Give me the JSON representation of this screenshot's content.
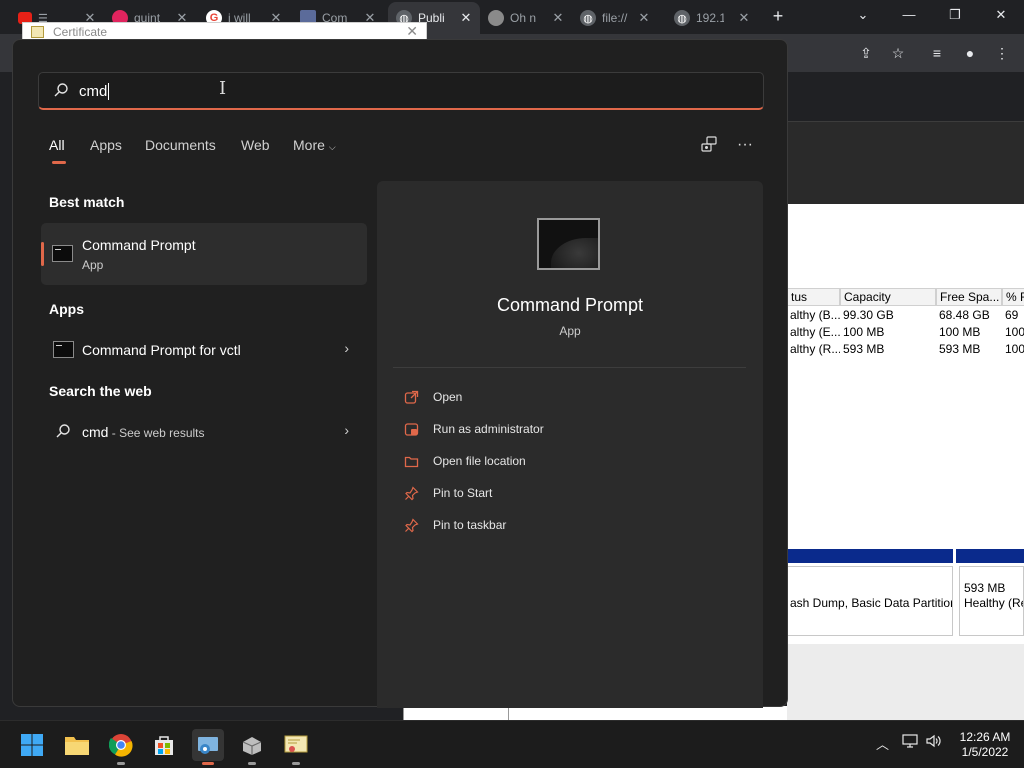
{
  "browser": {
    "tabs": [
      {
        "label": "",
        "active": false
      },
      {
        "label": "quint",
        "active": false
      },
      {
        "label": "i will",
        "active": false
      },
      {
        "label": "Com",
        "active": false
      },
      {
        "label": "Publi",
        "active": true
      },
      {
        "label": "Oh n",
        "active": false
      },
      {
        "label": "file://",
        "active": false
      },
      {
        "label": "192.1",
        "active": false
      }
    ]
  },
  "certificate": {
    "title": "Certificate"
  },
  "search": {
    "value": "cmd"
  },
  "filters": [
    {
      "label": "All",
      "selected": true
    },
    {
      "label": "Apps",
      "selected": false
    },
    {
      "label": "Documents",
      "selected": false
    },
    {
      "label": "Web",
      "selected": false
    },
    {
      "label": "More",
      "selected": false
    }
  ],
  "results": {
    "best_match_heading": "Best match",
    "best_match": {
      "title": "Command Prompt",
      "subtitle": "App"
    },
    "apps_heading": "Apps",
    "apps": [
      {
        "title": "Command Prompt for vctl"
      }
    ],
    "web_heading": "Search the web",
    "web": {
      "query": "cmd",
      "suffix": " - See web results"
    }
  },
  "preview": {
    "title": "Command Prompt",
    "subtitle": "App",
    "actions": [
      {
        "label": "Open",
        "icon": "open-external-icon"
      },
      {
        "label": "Run as administrator",
        "icon": "shield-admin-icon"
      },
      {
        "label": "Open file location",
        "icon": "folder-icon"
      },
      {
        "label": "Pin to Start",
        "icon": "pin-icon"
      },
      {
        "label": "Pin to taskbar",
        "icon": "pin-icon"
      }
    ]
  },
  "disk_manager": {
    "columns": [
      "tus",
      "Capacity",
      "Free Spa...",
      "% F"
    ],
    "rows": [
      [
        "althy (B...",
        "99.30 GB",
        "68.48 GB",
        "69"
      ],
      [
        "althy (E...",
        "100 MB",
        "100 MB",
        "100"
      ],
      [
        "althy (R...",
        "593 MB",
        "593 MB",
        "100"
      ]
    ],
    "partition_a": "ash Dump, Basic Data Partitior",
    "partition_b_size": "593 MB",
    "partition_b_status": "Healthy (Re"
  },
  "taskbar": {
    "apps": [
      "start-icon",
      "file-explorer-icon",
      "chrome-icon",
      "store-icon",
      "remote-desktop-icon",
      "vmware-icon",
      "certificate-icon"
    ],
    "time": "12:26 AM",
    "date": "1/5/2022"
  },
  "colors": {
    "accent": "#e0684a",
    "panel": "#202020",
    "preview": "#2b2b2b"
  }
}
